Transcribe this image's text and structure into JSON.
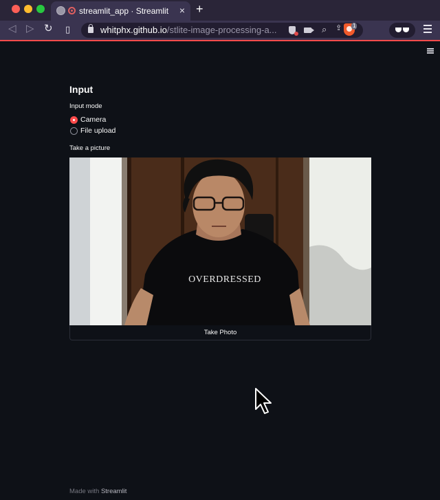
{
  "browser": {
    "tab_title": "streamlit_app · Streamlit",
    "tab_close": "×",
    "new_tab": "+",
    "url_host": "whitphx.github.io",
    "url_path": "/stlite-image-processing-a...",
    "brave_badge": "1",
    "icons": [
      "globe-icon",
      "recording-icon",
      "back-icon",
      "forward-icon",
      "reload-icon",
      "bookmark-icon",
      "lock-icon",
      "shield-blocked-icon",
      "camera-icon",
      "zoom-icon",
      "share-icon",
      "brave-icon",
      "private-glasses-icon",
      "menu-icon"
    ],
    "accent_color": "#ff4b4b"
  },
  "page": {
    "heading": "Input",
    "input_mode_label": "Input mode",
    "options": [
      {
        "label": "Camera",
        "selected": true
      },
      {
        "label": "File upload",
        "selected": false
      }
    ],
    "camera_label": "Take a picture",
    "shirt_text": "OVERDRESSED",
    "take_photo_label": "Take Photo",
    "footer_prefix": "Made with",
    "footer_brand": "Streamlit"
  }
}
